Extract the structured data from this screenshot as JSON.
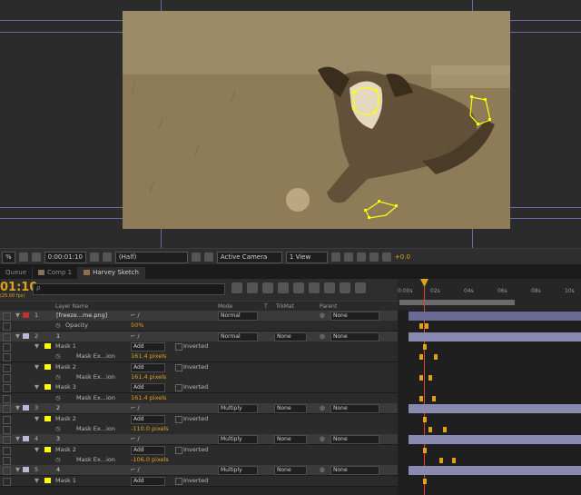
{
  "viewer": {
    "zoom": "%",
    "timecode": "0:00:01:10",
    "resolution": "(Half)",
    "camera": "Active Camera",
    "views": "1 View",
    "exposure": "+0.0"
  },
  "tabs": [
    {
      "label": "Queue",
      "swatch": ""
    },
    {
      "label": "Comp 1",
      "swatch": "#8a6f52"
    },
    {
      "label": "Harvey Sketch",
      "swatch": "#8a6f52"
    }
  ],
  "timeline": {
    "timecode": "01:10",
    "fps": "(25.00 fps)",
    "search_placeholder": "ρ",
    "columns": {
      "layer_name": "Layer Name",
      "mode": "Mode",
      "t": "T",
      "trkmat": "TrkMat",
      "parent": "Parent"
    },
    "ruler": [
      "0:00s",
      "02s",
      "04s",
      "06s",
      "08s",
      "10s"
    ]
  },
  "rows": [
    {
      "kind": "layer",
      "num": "1",
      "name": "[freeze...me.png]",
      "mode": "Normal",
      "trkmat": "",
      "parent": "None",
      "swatch": "#c03030",
      "bar": "#6a6a95"
    },
    {
      "kind": "prop",
      "name": "Opacity",
      "value": "50%"
    },
    {
      "kind": "layer",
      "num": "2",
      "name": "1",
      "mode": "Normal",
      "trkmat": "None",
      "parent": "None",
      "swatch": "#b8b8d8",
      "bar": "#8a8ab0"
    },
    {
      "kind": "mask",
      "name": "Mask 1",
      "maskmode": "Add",
      "inverted": "Inverted",
      "swatch": "#ffff00"
    },
    {
      "kind": "expansion",
      "name": "Mask Ex...ion",
      "value": "161.4 pixels"
    },
    {
      "kind": "mask",
      "name": "Mask 2",
      "maskmode": "Add",
      "inverted": "Inverted",
      "swatch": "#ffff00"
    },
    {
      "kind": "expansion",
      "name": "Mask Ex...ion",
      "value": "161.4 pixels"
    },
    {
      "kind": "mask",
      "name": "Mask 3",
      "maskmode": "Add",
      "inverted": "Inverted",
      "swatch": "#ffff00"
    },
    {
      "kind": "expansion",
      "name": "Mask Ex...ion",
      "value": "161.4 pixels"
    },
    {
      "kind": "layer",
      "num": "3",
      "name": "2",
      "mode": "Multiply",
      "trkmat": "None",
      "parent": "None",
      "swatch": "#b8b8d8",
      "bar": "#8a8ab0"
    },
    {
      "kind": "mask",
      "name": "Mask 2",
      "maskmode": "Add",
      "inverted": "Inverted",
      "swatch": "#ffff00"
    },
    {
      "kind": "expansion",
      "name": "Mask Ex...ion",
      "value": "-110.0 pixels"
    },
    {
      "kind": "layer",
      "num": "4",
      "name": "3",
      "mode": "Multiply",
      "trkmat": "None",
      "parent": "None",
      "swatch": "#b8b8d8",
      "bar": "#8a8ab0"
    },
    {
      "kind": "mask",
      "name": "Mask 2",
      "maskmode": "Add",
      "inverted": "Inverted",
      "swatch": "#ffff00"
    },
    {
      "kind": "expansion",
      "name": "Mask Ex...ion",
      "value": "-106.0 pixels"
    },
    {
      "kind": "layer",
      "num": "5",
      "name": "4",
      "mode": "Multiply",
      "trkmat": "None",
      "parent": "None",
      "swatch": "#b8b8d8",
      "bar": "#8a8ab0"
    },
    {
      "kind": "mask",
      "name": "Mask 1",
      "maskmode": "Add",
      "inverted": "Inverted",
      "swatch": "#ffff00"
    }
  ],
  "colors": {
    "accent": "#e0a21b",
    "mask": "#ffff00",
    "playhead": "#e0432e"
  }
}
